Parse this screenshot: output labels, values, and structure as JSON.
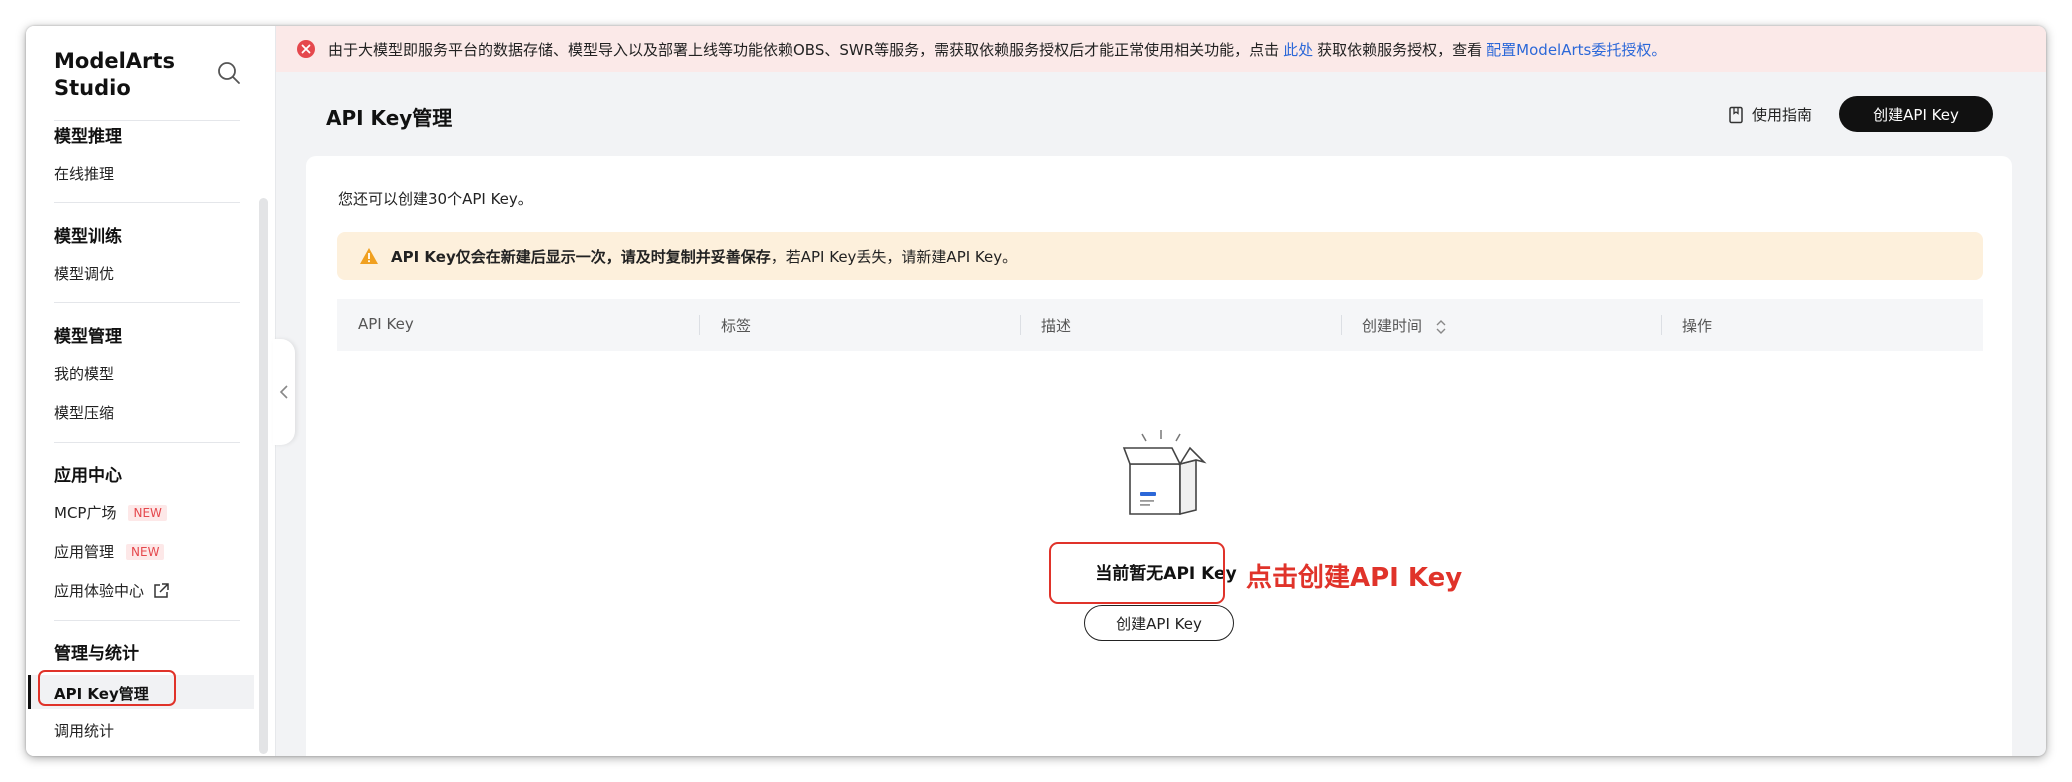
{
  "sidebar": {
    "brand": "ModelArts Studio",
    "groups": [
      {
        "title": "模型推理",
        "items": [
          "在线推理"
        ]
      },
      {
        "title": "模型训练",
        "items": [
          "模型调优"
        ]
      },
      {
        "title": "模型管理",
        "items": [
          "我的模型",
          "模型压缩"
        ]
      },
      {
        "title": "应用中心",
        "items": [
          "MCP广场",
          "应用管理",
          "应用体验中心"
        ]
      },
      {
        "title": "管理与统计",
        "items": [
          "API Key管理",
          "调用统计"
        ]
      }
    ],
    "new_badge": "NEW",
    "active_item": "API Key管理"
  },
  "banner": {
    "text_before": "由于大模型即服务平台的数据存储、模型导入以及部署上线等功能依赖OBS、SWR等服务，需获取依赖服务授权后才能正常使用相关功能，点击",
    "link1": "此处",
    "text_middle": "获取依赖服务授权，查看",
    "link2": "配置ModelArts委托授权。"
  },
  "header": {
    "title": "API Key管理",
    "guide_label": "使用指南",
    "create_label": "创建API Key"
  },
  "content": {
    "quota_text": "您还可以创建30个API Key。",
    "warning_bold": "API Key仅会在新建后显示一次，请及时复制并妥善保存",
    "warning_rest": "，若API Key丢失，请新建API Key。",
    "columns": [
      "API Key",
      "标签",
      "描述",
      "创建时间",
      "操作"
    ],
    "empty_text": "当前暂无API Key",
    "empty_create_label": "创建API Key"
  },
  "annotation": {
    "text": "点击创建API Key",
    "color": "#e0332a"
  },
  "colors": {
    "accent": "#111111",
    "link": "#2c68d8",
    "error": "#e5484d",
    "warning": "#f0a020"
  }
}
